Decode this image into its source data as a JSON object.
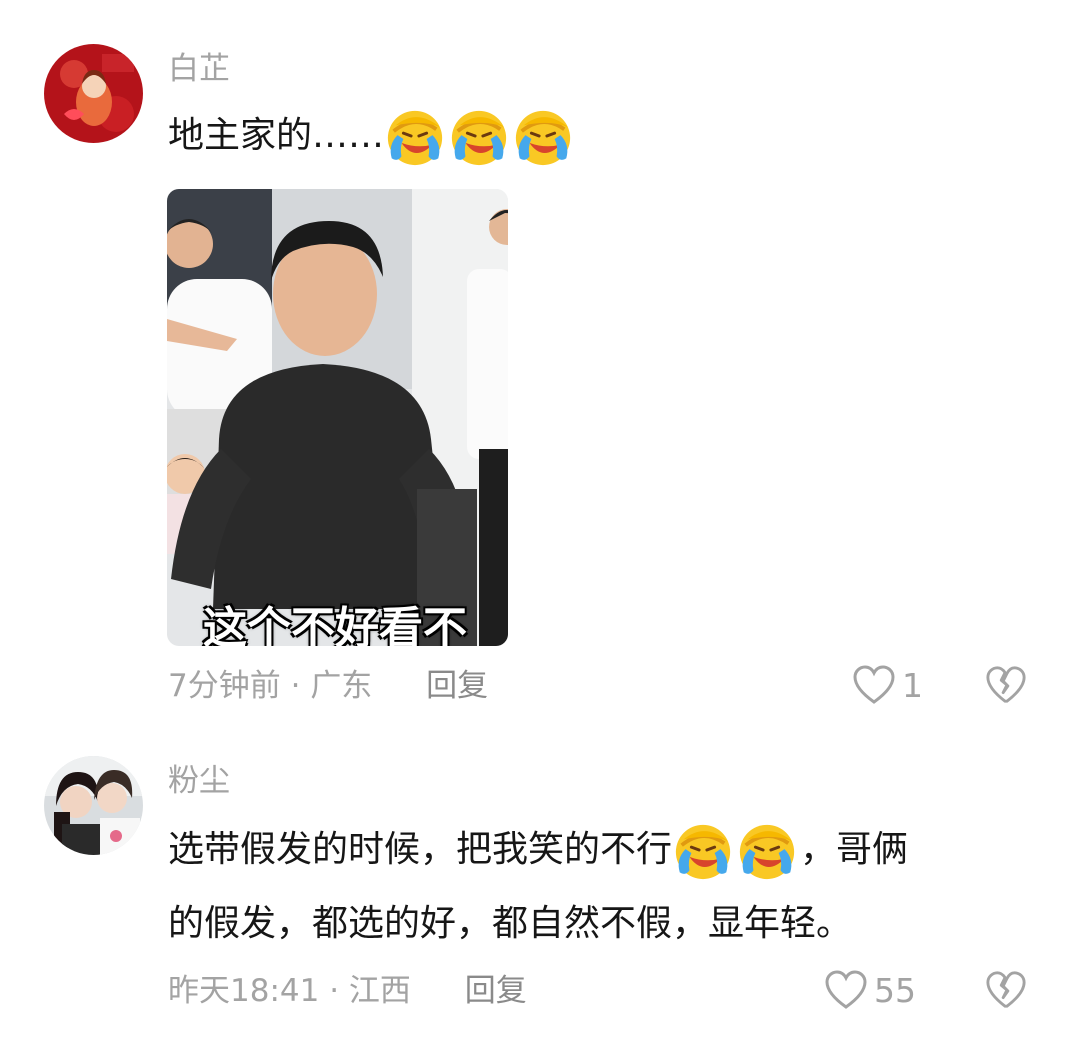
{
  "comments": [
    {
      "username": "白芷",
      "text": "地主家的……",
      "emojis": [
        "laugh-cry-emoji",
        "laugh-cry-emoji",
        "laugh-cry-emoji"
      ],
      "image_caption": "这个不好看不",
      "time": "7分钟前",
      "location": "广东",
      "reply_label": "回复",
      "like_count": "1"
    },
    {
      "username": "粉尘",
      "text_part1": "选带假发的时候，把我笑的不行",
      "emojis": [
        "laugh-cry-emoji",
        "laugh-cry-emoji"
      ],
      "text_part2": "，哥俩",
      "text_line2": "的假发，都选的好，都自然不假，显年轻。",
      "time": "昨天18:41",
      "location": "江西",
      "reply_label": "回复",
      "like_count": "55"
    }
  ],
  "meta_separator": "·",
  "icons": [
    "heart-outline-icon",
    "broken-heart-icon",
    "laugh-cry-emoji"
  ]
}
